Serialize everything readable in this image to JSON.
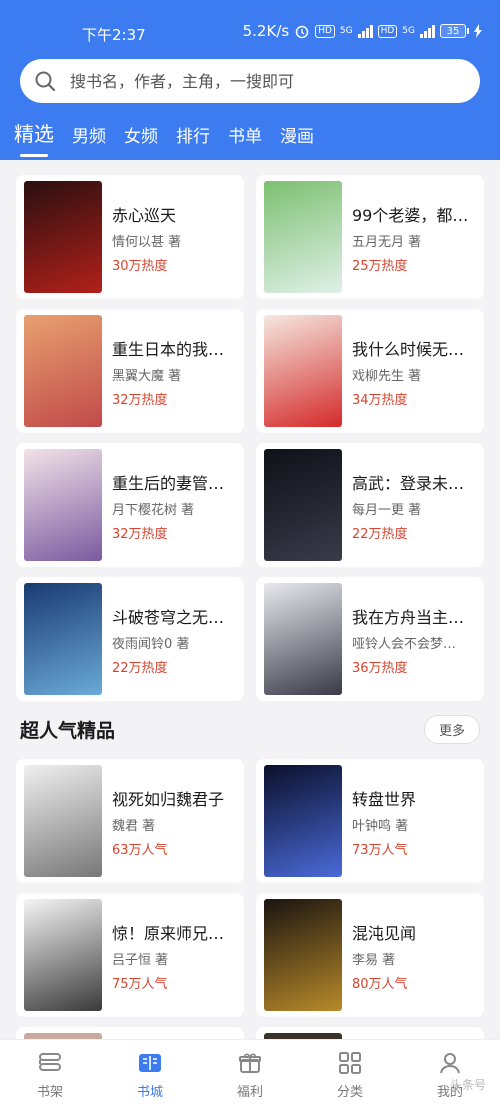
{
  "status": {
    "time": "下午2:37",
    "speed": "5.2K/s",
    "hd1": "HD",
    "net1": "5G",
    "hd2": "HD",
    "net2": "5G",
    "battery": "35"
  },
  "search": {
    "placeholder": "搜书名，作者，主角，一搜即可"
  },
  "tabs": [
    {
      "label": "精选",
      "active": true
    },
    {
      "label": "男频"
    },
    {
      "label": "女频"
    },
    {
      "label": "排行"
    },
    {
      "label": "书单"
    },
    {
      "label": "漫画"
    }
  ],
  "books": [
    {
      "title": "赤心巡天",
      "author": "情何以甚 著",
      "heat": "30万热度",
      "cover": [
        "#2a0f10",
        "#b3201a"
      ]
    },
    {
      "title": "99个老婆，都…",
      "author": "五月无月 著",
      "heat": "25万热度",
      "cover": [
        "#7cc070",
        "#e0f0e8"
      ]
    },
    {
      "title": "重生日本的我…",
      "author": "黑翼大魔 著",
      "heat": "32万热度",
      "cover": [
        "#e8a070",
        "#c04a4a"
      ]
    },
    {
      "title": "我什么时候无…",
      "author": "戏柳先生 著",
      "heat": "34万热度",
      "cover": [
        "#f5e8e0",
        "#d42a2a"
      ]
    },
    {
      "title": "重生后的妻管…",
      "author": "月下樱花树 著",
      "heat": "32万热度",
      "cover": [
        "#f2e2e8",
        "#7a5aa0"
      ]
    },
    {
      "title": "高武：登录未…",
      "author": "每月一更 著",
      "heat": "22万热度",
      "cover": [
        "#101018",
        "#3a3a4a"
      ]
    },
    {
      "title": "斗破苍穹之无…",
      "author": "夜雨闻铃0 著",
      "heat": "22万热度",
      "cover": [
        "#1a3a70",
        "#6aaad8"
      ]
    },
    {
      "title": "我在方舟当主…",
      "author": "哑铃人会不会梦…",
      "heat": "36万热度",
      "cover": [
        "#e8e8ee",
        "#3a3a48"
      ]
    }
  ],
  "section": {
    "title": "超人气精品",
    "more": "更多"
  },
  "featured": [
    {
      "title": "视死如归魏君子",
      "author": "魏君 著",
      "heat": "63万人气",
      "cover": [
        "#f0f0f0",
        "#777777"
      ]
    },
    {
      "title": "转盘世界",
      "author": "叶钟鸣 著",
      "heat": "73万人气",
      "cover": [
        "#0a0f2a",
        "#4a6ad8"
      ]
    },
    {
      "title": "惊！原来师兄…",
      "author": "吕子恒 著",
      "heat": "75万人气",
      "cover": [
        "#f5f5f5",
        "#3a3a3a"
      ]
    },
    {
      "title": "混沌见闻",
      "author": "李易 著",
      "heat": "80万人气",
      "cover": [
        "#1a1410",
        "#b88a2a"
      ]
    }
  ],
  "nav": [
    {
      "label": "书架",
      "icon": "bookshelf-icon"
    },
    {
      "label": "书城",
      "icon": "book-open-icon",
      "active": true
    },
    {
      "label": "福利",
      "icon": "gift-icon"
    },
    {
      "label": "分类",
      "icon": "category-grid-icon"
    },
    {
      "label": "我的",
      "icon": "user-icon"
    }
  ],
  "watermark": "头条号"
}
